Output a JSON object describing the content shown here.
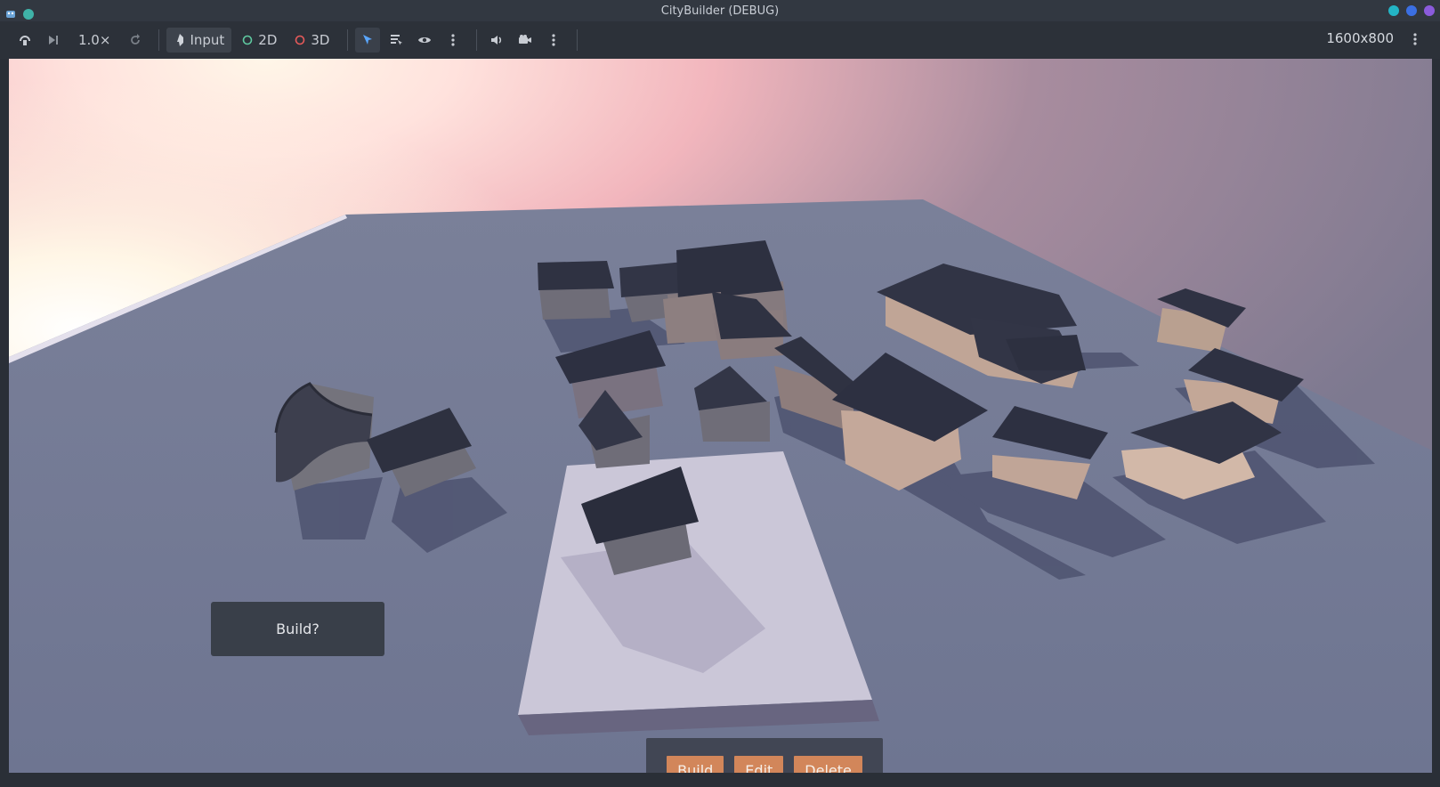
{
  "window": {
    "title": "CityBuilder (DEBUG)",
    "traffic_colors": [
      "#23b5c6",
      "#3b6fe3",
      "#8b5bdc"
    ]
  },
  "toolbar": {
    "speed": "1.0×",
    "input_label": "Input",
    "mode_2d_label": "2D",
    "mode_3d_label": "3D",
    "resolution": "1600x800",
    "icons": [
      "remote-debug-icon",
      "step-frame-icon",
      "reset-speed-icon",
      "input-icon",
      "select-icon",
      "list-select-icon",
      "visibility-icon",
      "more-icon",
      "audio-icon",
      "camera-icon",
      "more-icon"
    ]
  },
  "viewport": {
    "build_prompt": "Build?",
    "actions": {
      "build_label": "Build",
      "edit_label": "Edit",
      "delete_label": "Delete",
      "button_color": "#d2865a"
    }
  }
}
